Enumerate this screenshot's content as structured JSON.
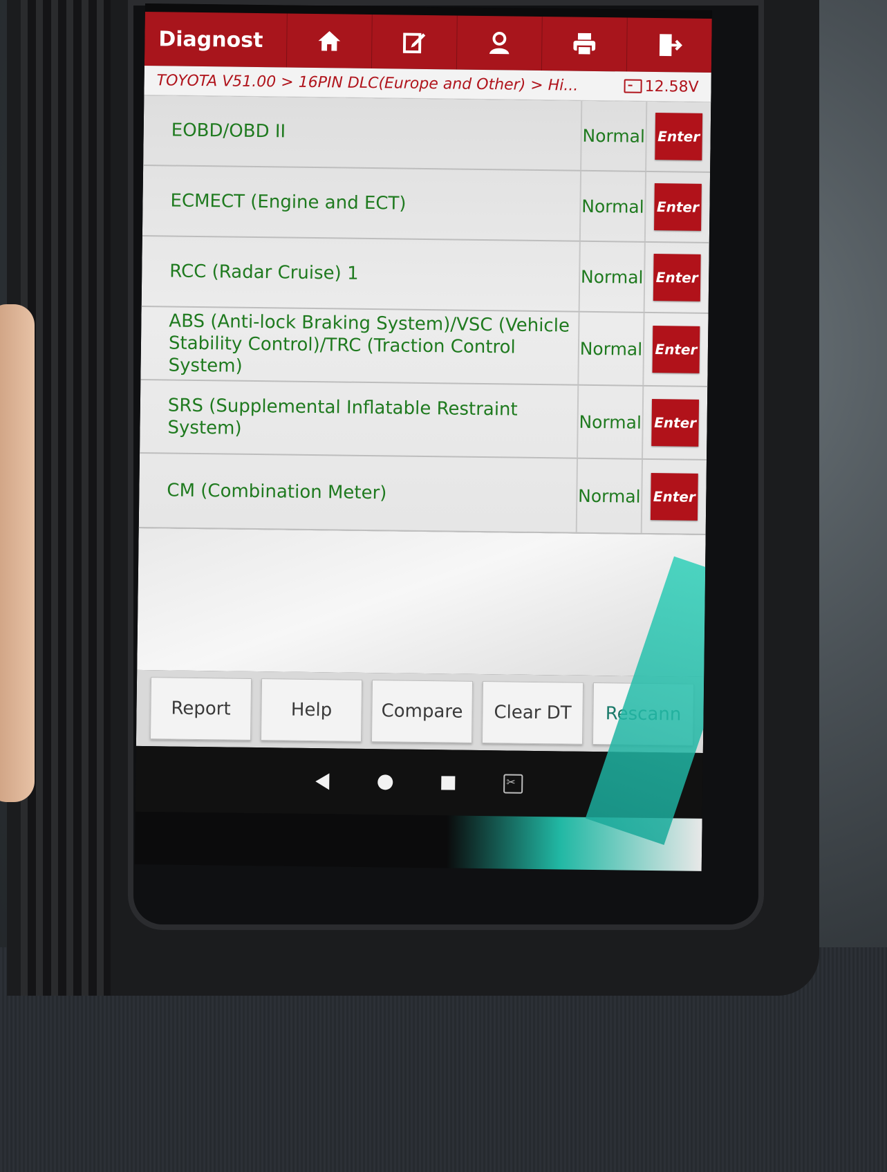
{
  "app_bar": {
    "title": "Diagnost",
    "icons": [
      "home-icon",
      "edit-icon",
      "user-icon",
      "print-icon",
      "exit-icon"
    ]
  },
  "breadcrumb": {
    "path": "TOYOTA V51.00 > 16PIN DLC(Europe and Other) > Hi...",
    "voltage": "12.58V"
  },
  "systems": [
    {
      "name": "EOBD/OBD II",
      "status": "Normal",
      "action": "Enter"
    },
    {
      "name": "ECMECT (Engine and ECT)",
      "status": "Normal",
      "action": "Enter"
    },
    {
      "name": "RCC (Radar Cruise) 1",
      "status": "Normal",
      "action": "Enter"
    },
    {
      "name": "ABS (Anti-lock Braking System)/VSC (Vehicle Stability Control)/TRC (Traction Control System)",
      "status": "Normal",
      "action": "Enter"
    },
    {
      "name": "SRS (Supplemental Inflatable Restraint System)",
      "status": "Normal",
      "action": "Enter"
    },
    {
      "name": "CM (Combination Meter)",
      "status": "Normal",
      "action": "Enter"
    }
  ],
  "bottom_buttons": {
    "report": "Report",
    "help": "Help",
    "compare": "Compare",
    "clear_dtc": "Clear DT",
    "rescan": "Rescann"
  },
  "colors": {
    "accent": "#a8151c",
    "text_green": "#1f7a1f",
    "enter_red": "#b1121a"
  }
}
